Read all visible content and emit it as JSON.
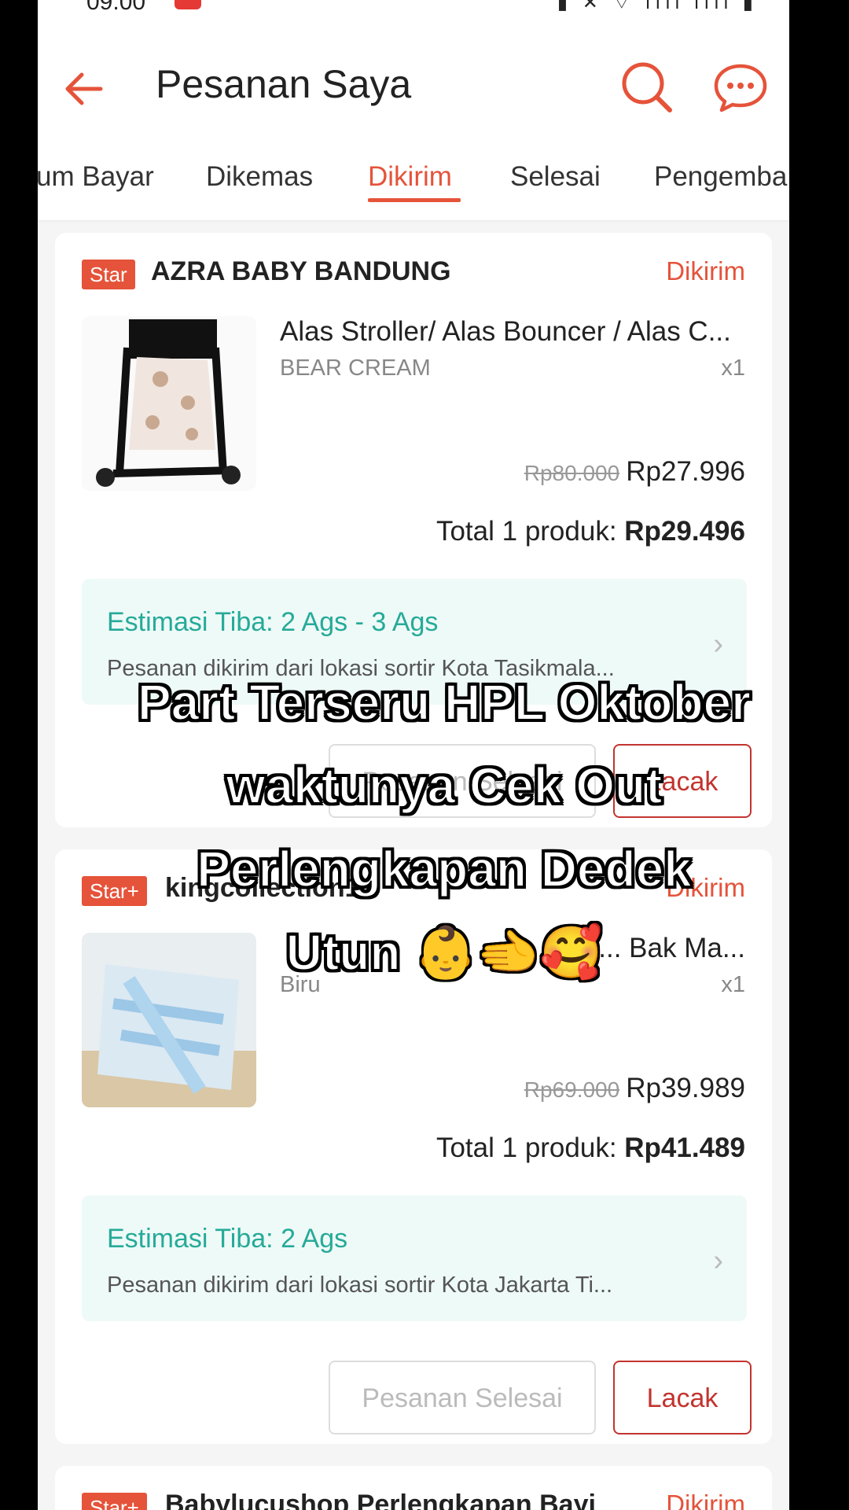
{
  "status": {
    "time": "09.00",
    "icons": "▮ ✕ ⌔ ıııl ıııl ▮"
  },
  "header": {
    "title": "Pesanan Saya",
    "back_icon": "arrow-left-icon",
    "search_icon": "search-icon",
    "chat_icon": "chat-icon"
  },
  "tabs": [
    {
      "label": "um Bayar"
    },
    {
      "label": "Dikemas"
    },
    {
      "label": "Dikirim",
      "active": true
    },
    {
      "label": "Selesai"
    },
    {
      "label": "Pengemba"
    }
  ],
  "orders": [
    {
      "badge": "Star",
      "shop": "AZRA BABY BANDUNG",
      "status": "Dikirim",
      "product": "Alas Stroller/ Alas Bouncer / Alas C...",
      "variant": "BEAR CREAM",
      "qty": "x1",
      "old_price": "Rp80.000",
      "price": "Rp27.996",
      "total_label": "Total 1 produk: ",
      "total": "Rp29.496",
      "estimate": "Estimasi Tiba: 2 Ags - 3 Ags",
      "estimate_sub": "Pesanan dikirim dari lokasi sortir Kota Tasikmala...",
      "btn_done": "Pesanan Selesai",
      "btn_track": "Lacak"
    },
    {
      "badge": "Star+",
      "shop": "kingcollection1",
      "status": "Dikirim",
      "product": "... Bak Ma...",
      "variant": "Biru",
      "qty": "x1",
      "old_price": "Rp69.000",
      "price": "Rp39.989",
      "total_label": "Total 1 produk: ",
      "total": "Rp41.489",
      "estimate": "Estimasi Tiba: 2 Ags",
      "estimate_sub": "Pesanan dikirim dari lokasi sortir Kota Jakarta Ti...",
      "btn_done": "Pesanan Selesai",
      "btn_track": "Lacak"
    },
    {
      "badge": "Star+",
      "shop": "Babylucushop Perlengkapan Bayi",
      "status": "Dikirim"
    }
  ],
  "caption": {
    "line1": "Part Terseru HPL Oktober",
    "line2": "waktunya Cek Out",
    "line3": "Perlengkapan Dedek",
    "line4": "Utun 👶🫲🥰"
  },
  "colors": {
    "accent": "#e5533a",
    "eta_green": "#26aa99",
    "eta_bg": "#eefaf7"
  }
}
